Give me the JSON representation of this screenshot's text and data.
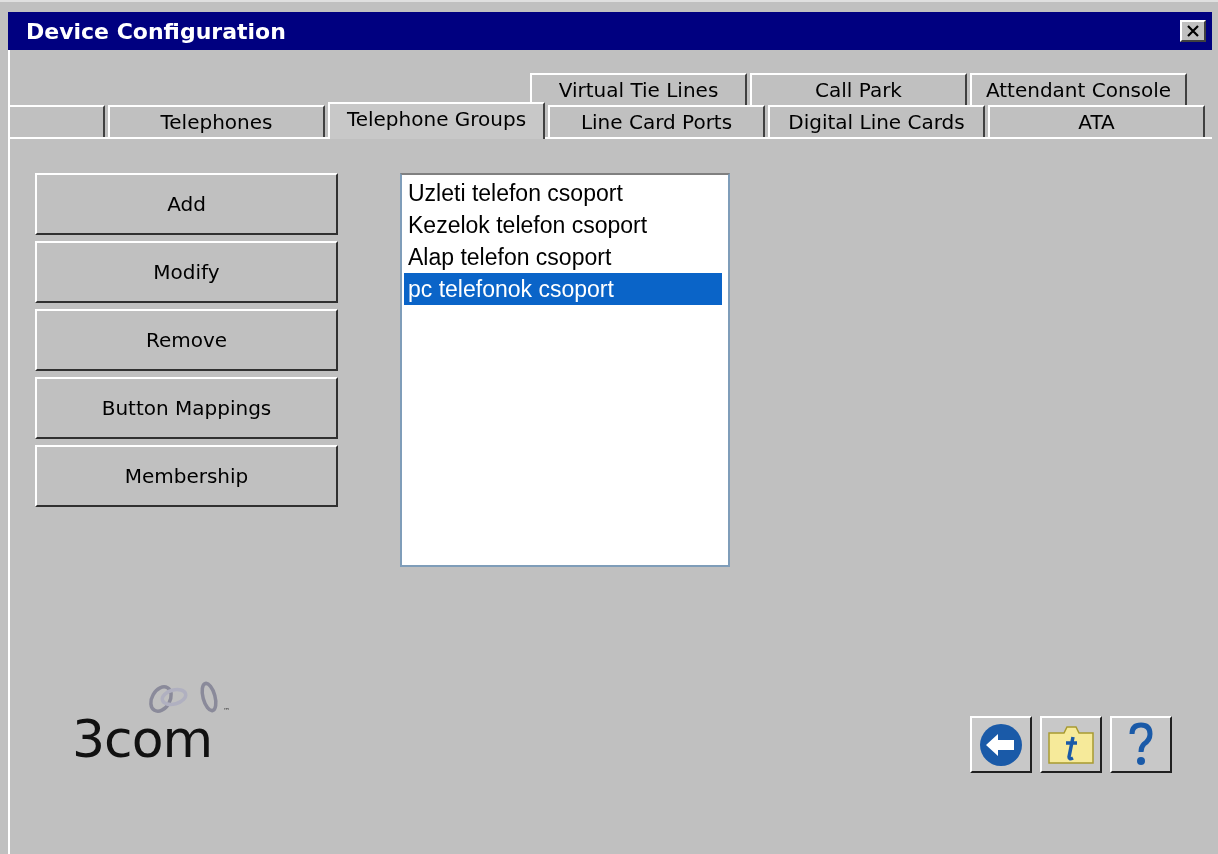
{
  "window": {
    "title": "Device Configuration"
  },
  "tab_rows": [
    {
      "tabs": [
        {
          "label": "Virtual Tie Lines",
          "selected": false
        },
        {
          "label": "Call Park",
          "selected": false
        },
        {
          "label": "Attendant Console",
          "selected": false
        }
      ]
    },
    {
      "tabs": [
        {
          "label": "Telephones",
          "selected": false
        },
        {
          "label": "Telephone Groups",
          "selected": true
        },
        {
          "label": "Line Card Ports",
          "selected": false
        },
        {
          "label": "Digital Line Cards",
          "selected": false
        },
        {
          "label": "ATA",
          "selected": false
        }
      ]
    }
  ],
  "buttons": [
    "Add",
    "Modify",
    "Remove",
    "Button Mappings",
    "Membership"
  ],
  "groups": [
    {
      "label": "Uzleti telefon csoport",
      "selected": false
    },
    {
      "label": "Kezelok telefon csoport",
      "selected": false
    },
    {
      "label": "Alap telefon csoport",
      "selected": false
    },
    {
      "label": "pc telefonok csoport",
      "selected": true
    }
  ],
  "logo": {
    "text": "3com",
    "trademark": "™"
  }
}
